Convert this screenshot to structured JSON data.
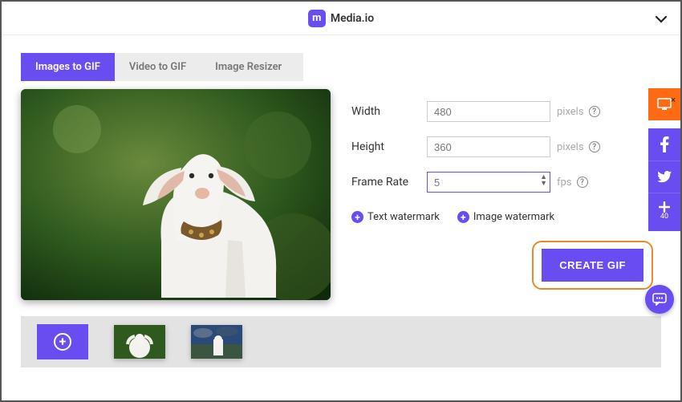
{
  "brand": {
    "name": "Media.io",
    "logo_letter": "m"
  },
  "tabs": [
    {
      "label": "Images to GIF",
      "active": true
    },
    {
      "label": "Video to GIF",
      "active": false
    },
    {
      "label": "Image Resizer",
      "active": false
    }
  ],
  "form": {
    "width": {
      "label": "Width",
      "value": "480",
      "unit": "pixels"
    },
    "height": {
      "label": "Height",
      "value": "360",
      "unit": "pixels"
    },
    "frame_rate": {
      "label": "Frame Rate",
      "value": "5",
      "unit": "fps"
    }
  },
  "watermarks": {
    "text": "Text watermark",
    "image": "Image watermark"
  },
  "cta_label": "CREATE GIF",
  "side_rail_count": "40",
  "thumbnails": [
    {
      "id": "goat-green"
    },
    {
      "id": "goat-sky"
    }
  ],
  "icons": {
    "help": "?",
    "collapse": "chevron-down",
    "close": "×",
    "add": "+"
  }
}
